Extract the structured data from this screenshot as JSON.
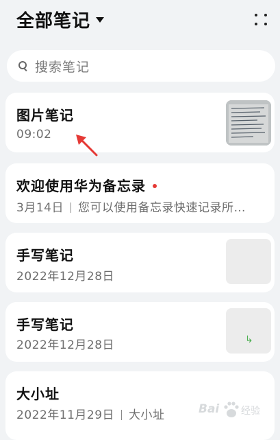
{
  "header": {
    "title": "全部笔记",
    "caret_icon": "caret-down-icon",
    "more_icon": "grid-dots-icon"
  },
  "search": {
    "placeholder": "搜索笔记",
    "icon": "search-icon"
  },
  "notes": [
    {
      "title": "图片笔记",
      "subtitle": "09:02",
      "thumbnail": "photo-thumbnail"
    },
    {
      "title": "欢迎使用华为备忘录",
      "date": "3月14日",
      "preview": "您可以使用备忘录快速记录所…",
      "unread_color": "#e53935"
    },
    {
      "title": "手写笔记",
      "subtitle": "2022年12月28日",
      "thumbnail": "handwriting-thumbnail"
    },
    {
      "title": "手写笔记",
      "subtitle": "2022年12月28日",
      "thumbnail": "handwriting-thumbnail",
      "thumb_glyph": "↳"
    },
    {
      "title": "大小址",
      "date": "2022年11月29日",
      "preview": "大小址"
    }
  ],
  "annotation": {
    "arrow_color": "#e53935",
    "arrow_icon": "red-arrow-icon"
  },
  "watermark": {
    "brand": "Bai",
    "suffix": "经验",
    "icon": "paw-icon"
  },
  "colors": {
    "background": "#f1f3f5",
    "card": "#ffffff",
    "accent_dot": "#e53935"
  }
}
